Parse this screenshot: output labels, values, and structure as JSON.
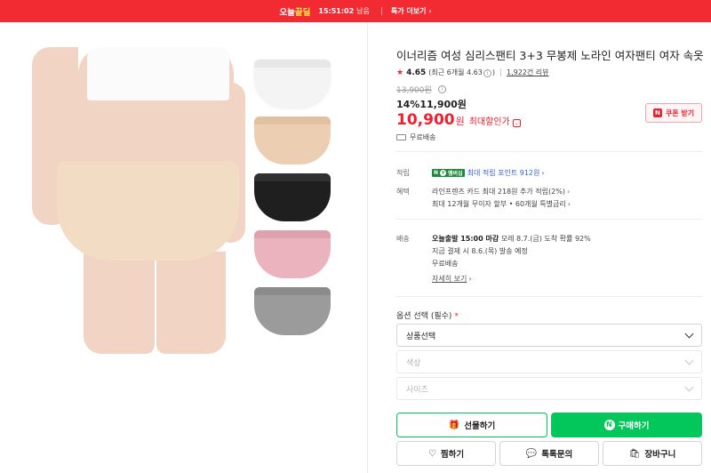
{
  "topbar": {
    "logo_left": "오늘",
    "logo_right": "끝딜",
    "countdown": "15:51:02",
    "remain_label": "남음",
    "more_label": "특가 더보기",
    "more_chevron": "›",
    "background": "#f22b32"
  },
  "product": {
    "title": "이너리즘 여성 심리스팬티 3+3 무봉제 노라인 여자팬티 여자 속옷",
    "rating": {
      "star": "★",
      "score": "4.65",
      "recent_text": "(최근 6개월 4.63",
      "recent_suffix": ")",
      "info_icon": "i",
      "reviews": "1,922건 리뷰"
    },
    "original_price": "13,900원",
    "discount_price": "14%11,900원",
    "max_discount": {
      "amount": "10,900",
      "unit": "원",
      "label": "최대할인가",
      "dropdown_glyph": "⌄"
    },
    "coupon_button": "쿠폰 받기",
    "coupon_icon_letter": "N",
    "free_shipping": "무료배송",
    "colors": {
      "panties": [
        "#f4f4f4",
        "#eccfb3",
        "#1f1f1f",
        "#eab3bd",
        "#9b9b9b"
      ],
      "accent_red": "#f0202f",
      "accent_green": "#03c75a"
    }
  },
  "points": {
    "label": "적립",
    "npay_left": "N",
    "npay_plus": "+",
    "npay_right": "멤버십",
    "text": "최대 적립 포인트 912원",
    "chevron": "›"
  },
  "benefit": {
    "label": "혜택",
    "line1": "라인프렌즈 카드 최대 218원 추가 적립(2%)",
    "line2": "최대 12개월 무이자 할부 • 60개월 특별금리",
    "chevron": "›"
  },
  "shipping": {
    "label": "배송",
    "line1_bold": "오늘출발 15:00 마감",
    "line1_rest": "  모레 8.7.(금) 도착 확률 92%",
    "line2": "지금 결제 시 8.6.(목) 발송 예정",
    "line3": "무료배송",
    "details_link": "자세히 보기",
    "chevron": "›"
  },
  "options": {
    "label": "옵션 선택 (필수)",
    "required_mark": "*",
    "selects": [
      {
        "placeholder": "상품선택"
      },
      {
        "placeholder": "색상"
      },
      {
        "placeholder": "사이즈"
      }
    ]
  },
  "actions": {
    "gift": "선물하기",
    "gift_icon": "🎁",
    "buy": "구매하기",
    "buy_icon_letter": "N",
    "wish": "찜하기",
    "wish_icon": "♡",
    "talk": "톡톡문의",
    "talk_icon": "💬",
    "cart": "장바구니",
    "cart_icon": "🛍"
  }
}
